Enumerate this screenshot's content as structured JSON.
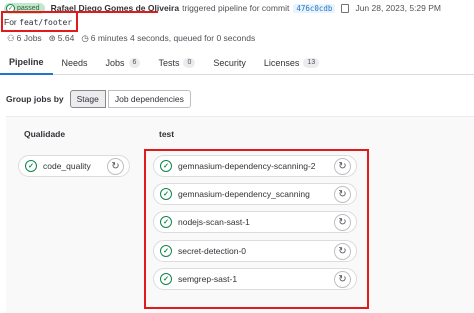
{
  "header": {
    "status": "passed",
    "author": "Rafael Diego Gomes de Oliveira",
    "triggered_text": "triggered pipeline for commit",
    "commit_sha": "476c0cdb",
    "date": "Jun 28, 2023, 5:29 PM"
  },
  "ref_line": {
    "prefix": "For",
    "ref": "feat/footer"
  },
  "meta": {
    "jobs": "6 Jobs",
    "size": "5.64",
    "duration": "6 minutes 4 seconds, queued for 0 seconds"
  },
  "tabs": [
    {
      "label": "Pipeline",
      "count": null
    },
    {
      "label": "Needs",
      "count": null
    },
    {
      "label": "Jobs",
      "count": "6"
    },
    {
      "label": "Tests",
      "count": "0"
    },
    {
      "label": "Security",
      "count": null
    },
    {
      "label": "Licenses",
      "count": "13"
    }
  ],
  "group_by": {
    "label": "Group jobs by",
    "options": [
      "Stage",
      "Job dependencies"
    ],
    "selected": "Stage"
  },
  "stages": [
    {
      "title": "Qualidade",
      "jobs": [
        "code_quality"
      ]
    },
    {
      "title": "test",
      "jobs": [
        "gemnasium-dependency-scanning-2",
        "gemnasium-dependency_scanning",
        "nodejs-scan-sast-1",
        "secret-detection-0",
        "semgrep-sast-1"
      ]
    }
  ],
  "colors": {
    "success": "#108548",
    "link": "#1f75cb",
    "annotation_red": "#e01b1b"
  }
}
